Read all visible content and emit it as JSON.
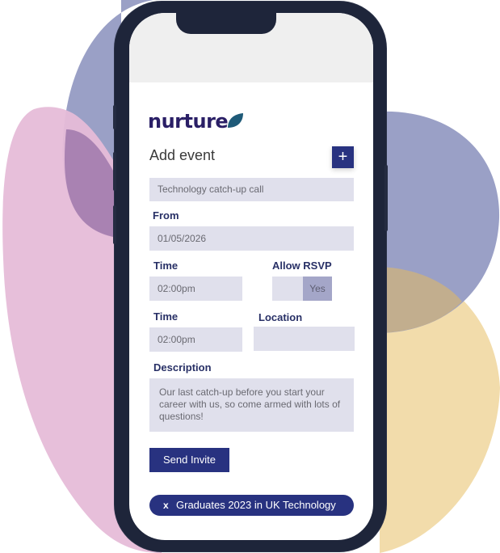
{
  "colors": {
    "brand": "#283280",
    "logo": "#2a1f66",
    "leaf": "#1e5a78",
    "field_bg": "#e0e0ec",
    "toggle_active": "#a4a6c8",
    "blob_blue": "#9aa0c6",
    "blob_pink": "#e6bcd8",
    "blob_yellow": "#f2dcab",
    "phone_frame": "#1e253a"
  },
  "app": {
    "logo_text": "nurture",
    "logo_icon": "leaf-icon"
  },
  "form": {
    "title": "Add event",
    "add_button_label": "+",
    "event_name_value": "Technology catch-up call",
    "from_label": "From",
    "from_value": "01/05/2026",
    "time1_label": "Time",
    "time1_value": "02:00pm",
    "rsvp_label": "Allow RSVP",
    "rsvp_value": "Yes",
    "time2_label": "Time",
    "time2_value": "02:00pm",
    "location_label": "Location",
    "location_value": "",
    "description_label": "Description",
    "description_value": "Our last catch-up before you start your career with us, so come armed with lots of questions!",
    "send_button_label": "Send Invite",
    "recipient_chip": {
      "remove_label": "x",
      "text": "Graduates 2023 in UK Technology"
    }
  }
}
